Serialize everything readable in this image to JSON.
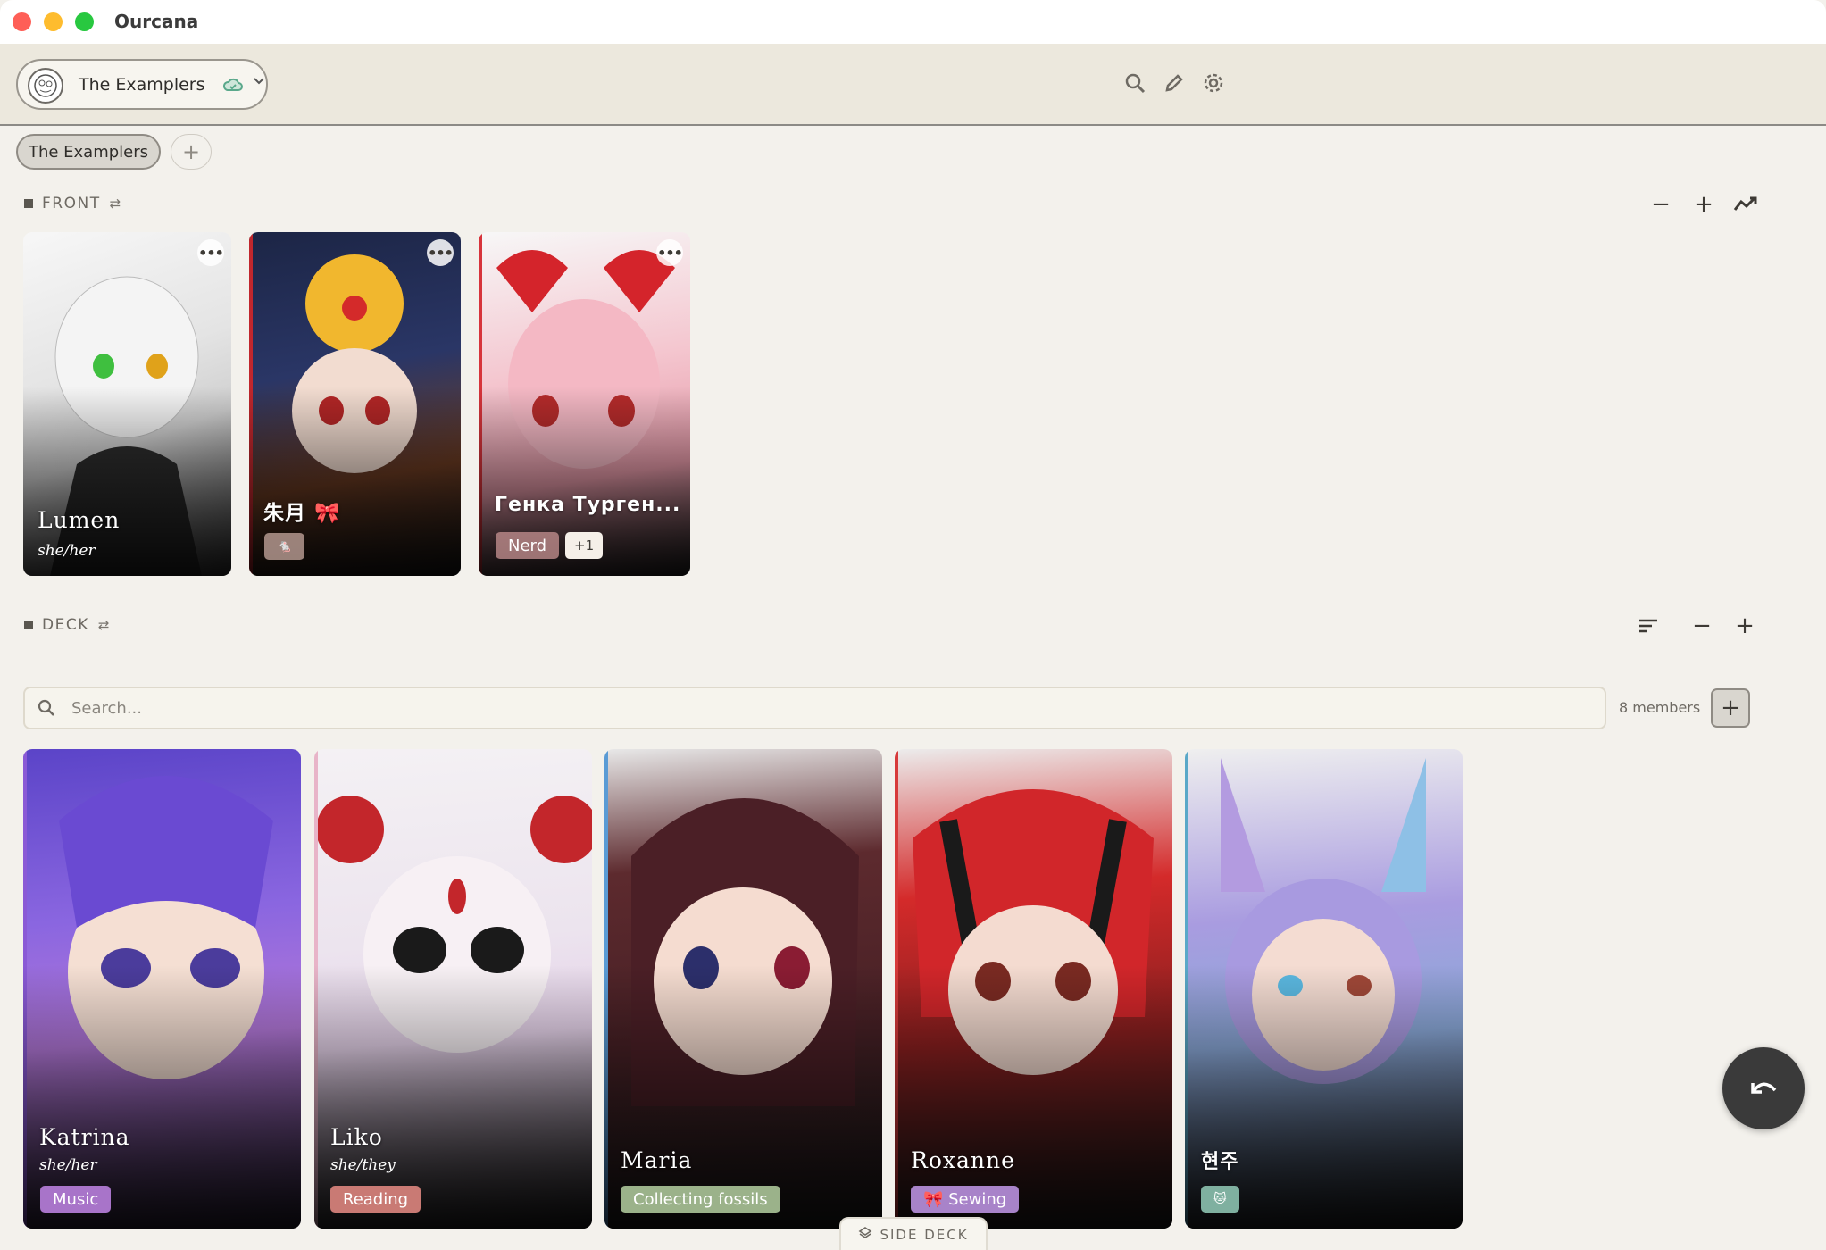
{
  "app": {
    "title": "Ourcana"
  },
  "header": {
    "system_name": "The Examplers",
    "icons": [
      "search-icon",
      "pencil-icon",
      "gear-icon",
      "cloud-icon",
      "chevron-down-icon"
    ]
  },
  "tabs": {
    "active": "The Examplers",
    "add_label": "+"
  },
  "front": {
    "label": "FRONT",
    "controls": [
      "−",
      "+"
    ],
    "cards": [
      {
        "name": "Lumen",
        "pronouns": "she/her",
        "tags": [],
        "accent": "#ffffff"
      },
      {
        "name": "朱月 🎀",
        "pronouns": "",
        "tags": [
          "🐁"
        ],
        "accent": "#c0272d"
      },
      {
        "name": "Генка Турген...",
        "pronouns": "",
        "tags": [
          "Nerd",
          "+1"
        ],
        "accent": "#d7343b"
      }
    ]
  },
  "deck": {
    "label": "DECK",
    "controls": [
      "−",
      "+"
    ],
    "search_placeholder": "Search...",
    "member_count": "8 members",
    "add_label": "+",
    "cards": [
      {
        "name": "Katrina",
        "pronouns": "she/her",
        "tags": [
          "Music"
        ],
        "accent": "#8a5ad6"
      },
      {
        "name": "Liko",
        "pronouns": "she/they",
        "tags": [
          "Reading"
        ],
        "accent": "#e8b4c8"
      },
      {
        "name": "Maria",
        "pronouns": "",
        "tags": [
          "Collecting fossils"
        ],
        "accent": "#5a9bd5"
      },
      {
        "name": "Roxanne",
        "pronouns": "",
        "tags": [
          "🎀 Sewing"
        ],
        "accent": "#d73a3a"
      },
      {
        "name": "현주",
        "pronouns": "",
        "tags": [
          "🐱"
        ],
        "accent": "#5aa8c8"
      }
    ]
  },
  "side_deck": {
    "label": "SIDE DECK"
  },
  "colors": {
    "accent": "#3a3a3a",
    "background": "#f3f1ec"
  }
}
